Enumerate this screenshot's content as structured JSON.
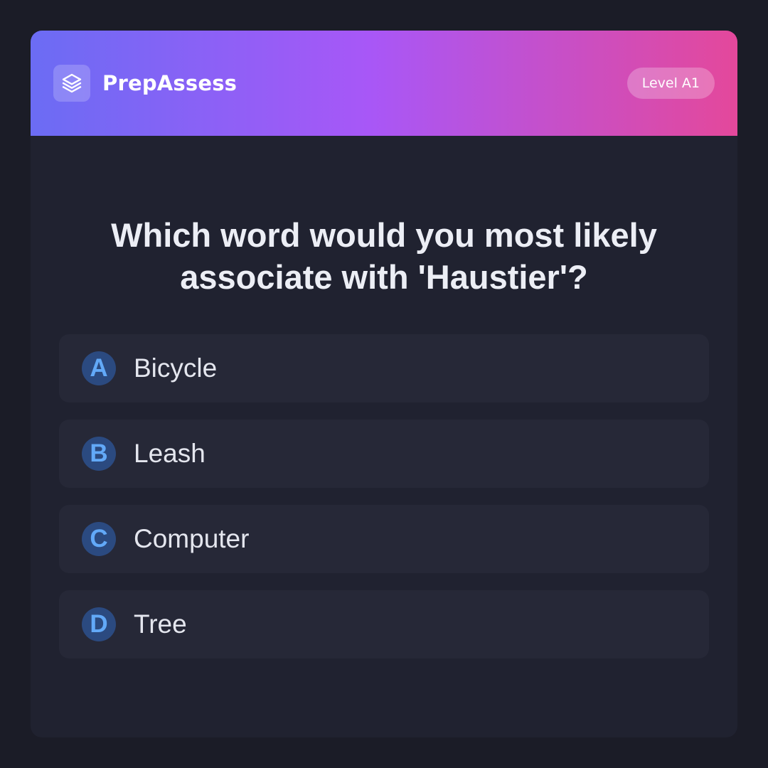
{
  "header": {
    "brand": "PrepAssess",
    "level": "Level A1",
    "logo_icon": "layers-icon"
  },
  "question": {
    "text": "Which word would you most likely associate with 'Haustier'?"
  },
  "options": [
    {
      "letter": "A",
      "text": "Bicycle"
    },
    {
      "letter": "B",
      "text": "Leash"
    },
    {
      "letter": "C",
      "text": "Computer"
    },
    {
      "letter": "D",
      "text": "Tree"
    }
  ],
  "colors": {
    "accent_start": "#6b6cf4",
    "accent_mid": "#a857f7",
    "accent_end": "#e4489b",
    "letter": "#62a9f8"
  }
}
